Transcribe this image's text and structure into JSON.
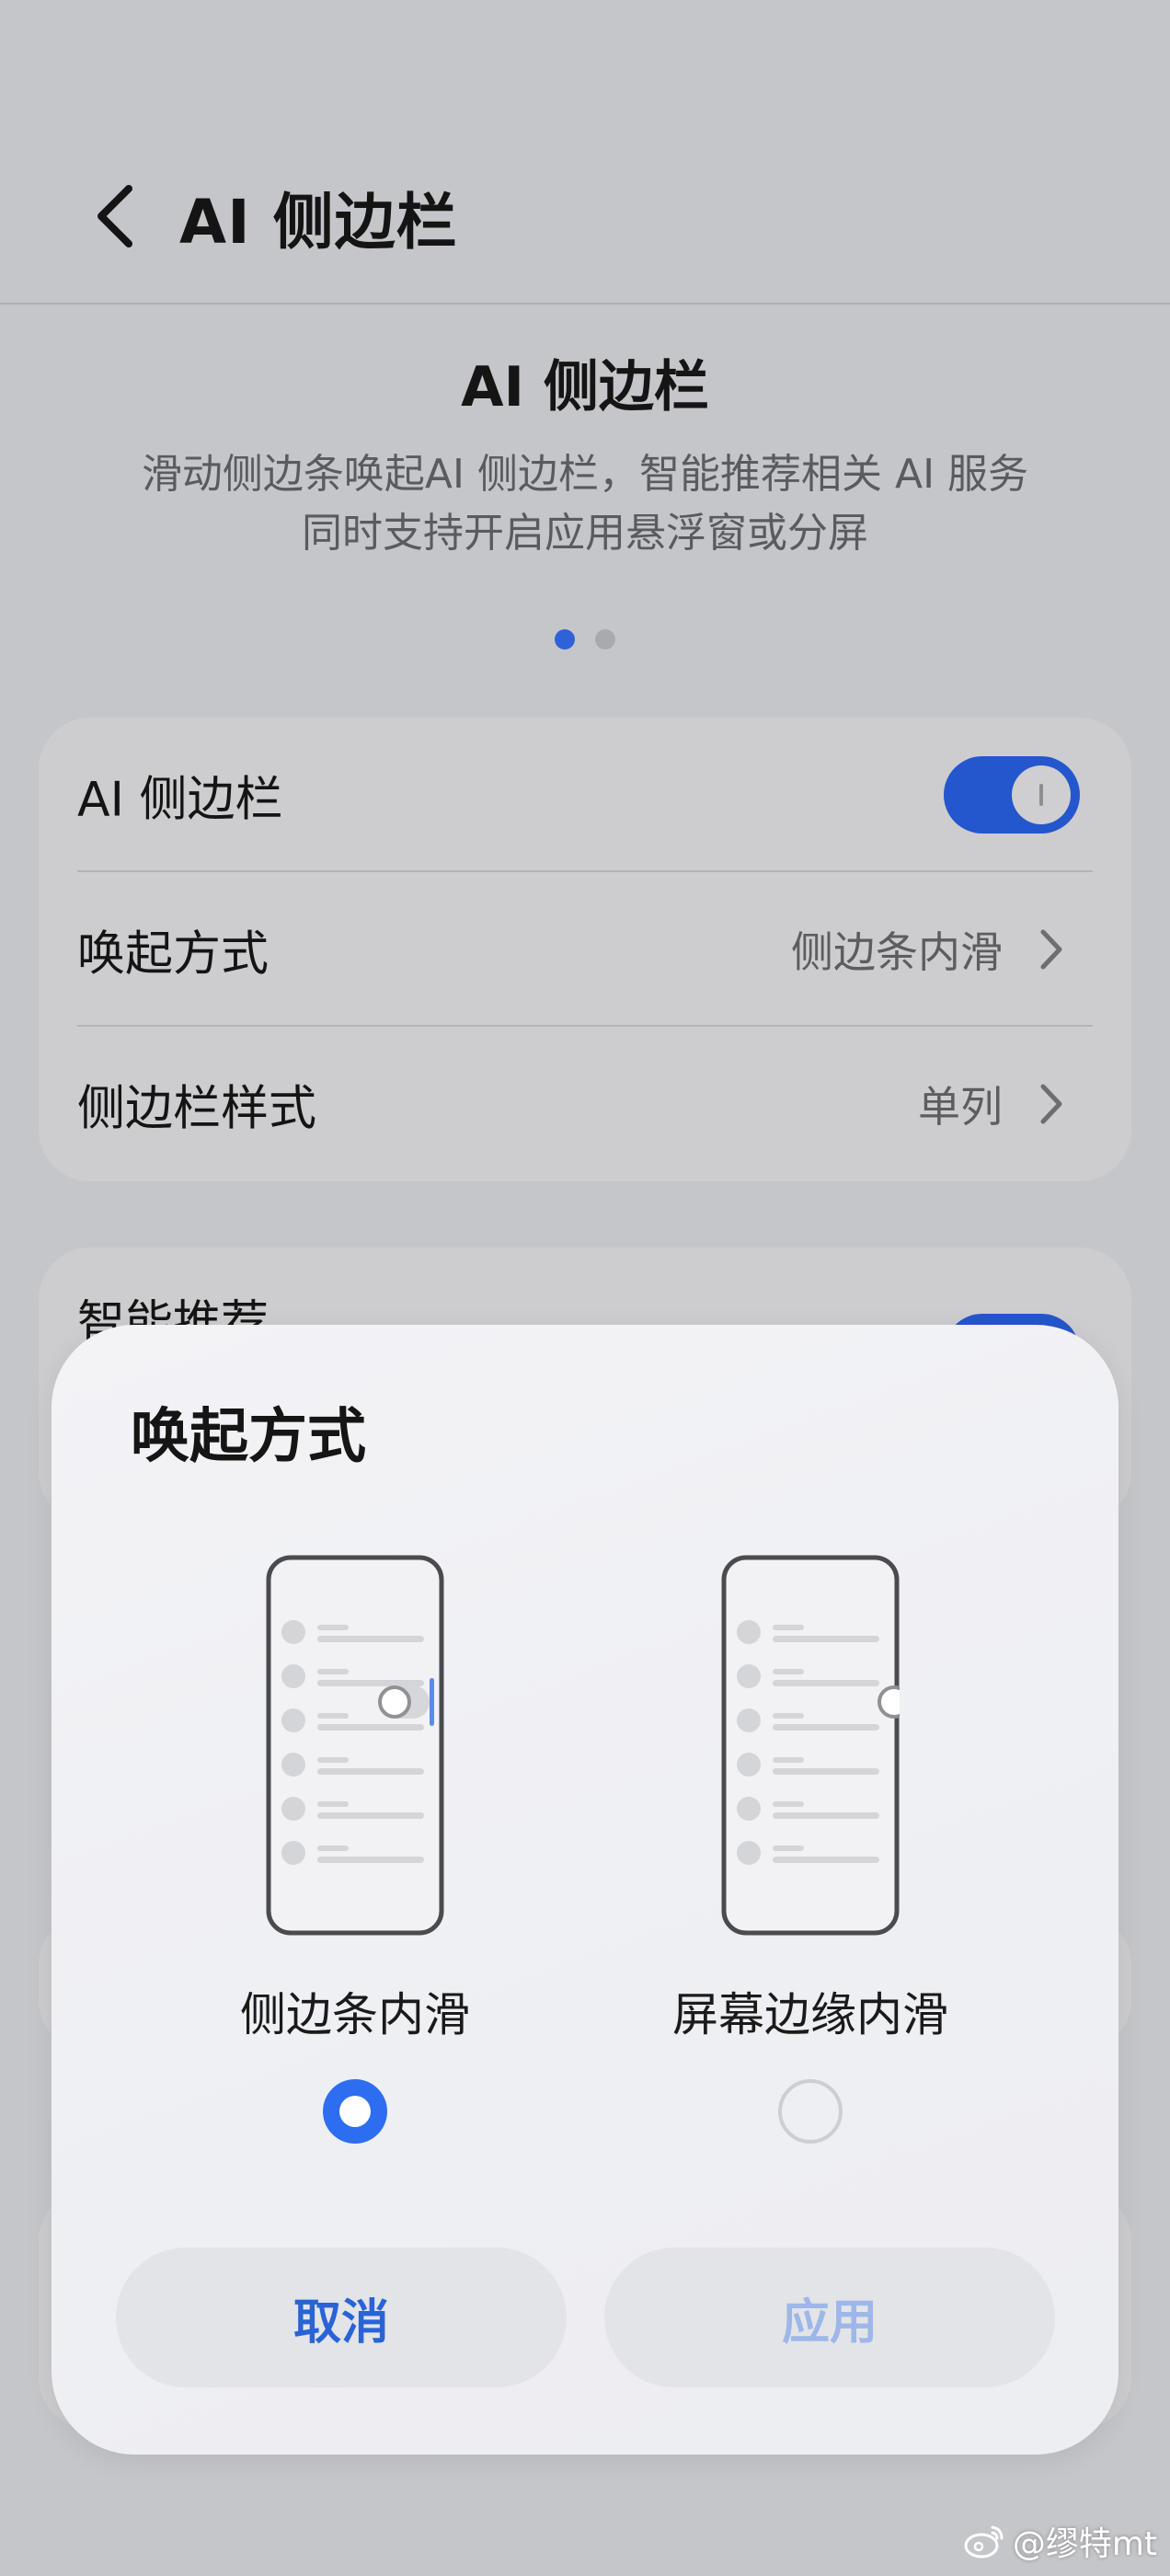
{
  "header": {
    "title": "AI 侧边栏"
  },
  "intro": {
    "title": "AI 侧边栏",
    "description_lines": [
      "滑动侧边条唤起AI 侧边栏，智能推荐相关 AI 服务",
      "同时支持开启应用悬浮窗或分屏"
    ],
    "page_indicator": {
      "current": 1,
      "total": 2
    }
  },
  "settings": {
    "rows": [
      {
        "label": "AI 侧边栏",
        "toggle": true
      },
      {
        "label": "唤起方式",
        "value": "侧边条内滑"
      },
      {
        "label": "侧边栏样式",
        "value": "单列"
      }
    ],
    "partial_row": {
      "label": "智能推荐",
      "toggle": true
    }
  },
  "sheet": {
    "title": "唤起方式",
    "options": [
      {
        "label": "侧边条内滑",
        "selected": true
      },
      {
        "label": "屏幕边缘内滑",
        "selected": false
      }
    ],
    "cancel_label": "取消",
    "apply_label": "应用"
  },
  "watermark": {
    "text": "@缪特mt"
  },
  "colors": {
    "accent": "#2d6ef0",
    "toggle_on": "#2456cd",
    "background": "#c5c6c9",
    "sheet_bg": "#f0f1f4"
  },
  "icons": {
    "back": "chevron-left-icon",
    "row_arrow": "chevron-right-icon",
    "watermark": "weibo-icon"
  }
}
